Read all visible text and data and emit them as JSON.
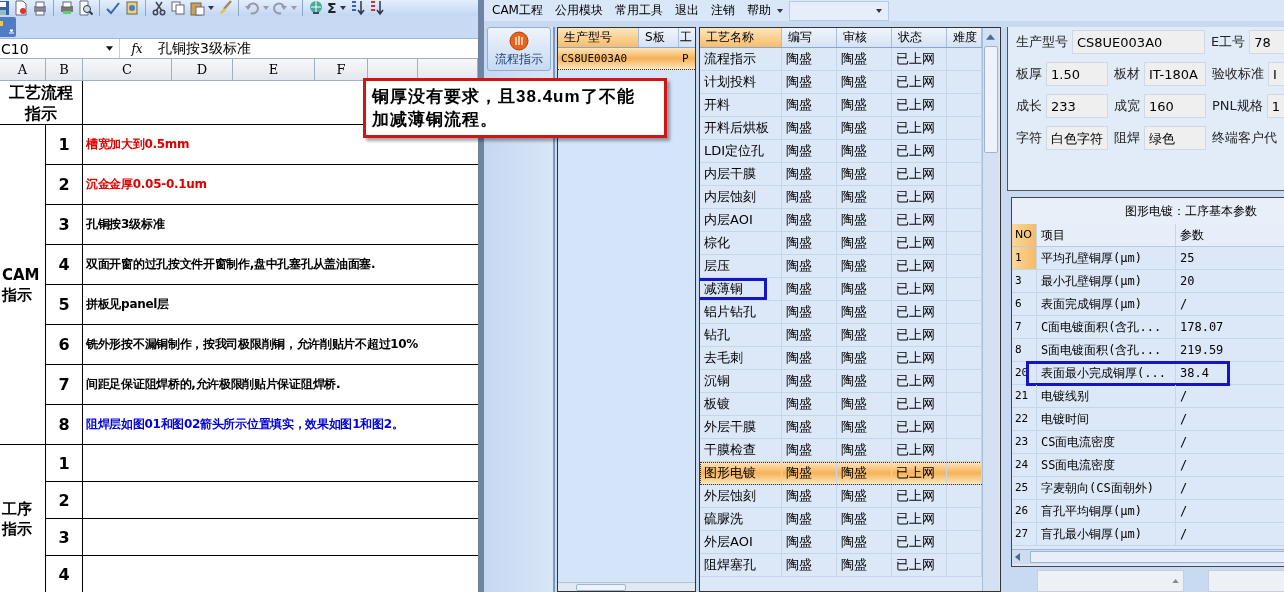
{
  "excel": {
    "toolbar_symbol": "Σ",
    "name_box": "C10",
    "fx": "fx",
    "formula": "孔铜按3级标准",
    "columns": [
      "A",
      "B",
      "C",
      "D",
      "E",
      "F",
      "",
      ""
    ],
    "header_label": "工艺流程指示",
    "groups": [
      {
        "label": "CAM指示",
        "rows": [
          {
            "no": "1",
            "text": "槽宽加大到0.5mm",
            "color": "#e00000"
          },
          {
            "no": "2",
            "text": "沉金金厚0.05-0.1um",
            "color": "#e00000"
          },
          {
            "no": "3",
            "text": "孔铜按3级标准",
            "color": "#000000"
          },
          {
            "no": "4",
            "text": "双面开窗的过孔按文件开窗制作,盘中孔塞孔从盖油面塞.",
            "color": "#000000"
          },
          {
            "no": "5",
            "text": "拼板见panel层",
            "color": "#000000"
          },
          {
            "no": "6",
            "text": "铣外形按不漏铜制作，按我司极限削铜，允许削贴片不超过10%",
            "color": "#000000"
          },
          {
            "no": "7",
            "text": "间距足保证阻焊桥的,允许极限削贴片保证阻焊桥.",
            "color": "#000000"
          },
          {
            "no": "8",
            "text": "阻焊层如图01和图02箭头所示位置填实，效果如图1和图2。",
            "color": "#0000dd"
          }
        ]
      },
      {
        "label": "工序指示",
        "rows": [
          {
            "no": "1"
          },
          {
            "no": "2"
          },
          {
            "no": "3"
          },
          {
            "no": "4"
          }
        ]
      }
    ]
  },
  "annotation": {
    "lines": [
      "铜厚没有要求，且38.4um了不能",
      "加减薄铜流程。"
    ]
  },
  "cam": {
    "menu": [
      "CAM工程",
      "公用模块",
      "常用工具",
      "退出",
      "注销",
      "帮助"
    ],
    "nav_button": "流程指示",
    "orders": {
      "columns": [
        {
          "label": "生产型号",
          "sorted": true
        },
        {
          "label": "S板",
          "sorted": false
        },
        {
          "label": "工",
          "sorted": false
        }
      ],
      "rows": [
        {
          "cells": [
            "CS8UE003A0",
            "",
            "P"
          ],
          "selected": true
        }
      ]
    },
    "processes": {
      "columns": [
        {
          "label": "工艺名称",
          "sorted": true
        },
        {
          "label": "编写",
          "sorted": false
        },
        {
          "label": "审核",
          "sorted": false
        },
        {
          "label": "状态",
          "sorted": false
        },
        {
          "label": "难度",
          "sorted": false
        }
      ],
      "rows": [
        {
          "name": "流程指示",
          "writer": "陶盛",
          "reviewer": "陶盛",
          "status": "已上网",
          "selected": false,
          "highlighted": false
        },
        {
          "name": "计划投料",
          "writer": "陶盛",
          "reviewer": "陶盛",
          "status": "已上网",
          "selected": false,
          "highlighted": false
        },
        {
          "name": "开料",
          "writer": "陶盛",
          "reviewer": "陶盛",
          "status": "已上网",
          "selected": false,
          "highlighted": false
        },
        {
          "name": "开料后烘板",
          "writer": "陶盛",
          "reviewer": "陶盛",
          "status": "已上网",
          "selected": false,
          "highlighted": false
        },
        {
          "name": "LDI定位孔",
          "writer": "陶盛",
          "reviewer": "陶盛",
          "status": "已上网",
          "selected": false,
          "highlighted": false
        },
        {
          "name": "内层干膜",
          "writer": "陶盛",
          "reviewer": "陶盛",
          "status": "已上网",
          "selected": false,
          "highlighted": false
        },
        {
          "name": "内层蚀刻",
          "writer": "陶盛",
          "reviewer": "陶盛",
          "status": "已上网",
          "selected": false,
          "highlighted": false
        },
        {
          "name": "内层AOI",
          "writer": "陶盛",
          "reviewer": "陶盛",
          "status": "已上网",
          "selected": false,
          "highlighted": false
        },
        {
          "name": "棕化",
          "writer": "陶盛",
          "reviewer": "陶盛",
          "status": "已上网",
          "selected": false,
          "highlighted": false
        },
        {
          "name": "层压",
          "writer": "陶盛",
          "reviewer": "陶盛",
          "status": "已上网",
          "selected": false,
          "highlighted": false
        },
        {
          "name": "减薄铜",
          "writer": "陶盛",
          "reviewer": "陶盛",
          "status": "已上网",
          "selected": false,
          "highlighted": true
        },
        {
          "name": "铝片钻孔",
          "writer": "陶盛",
          "reviewer": "陶盛",
          "status": "已上网",
          "selected": false,
          "highlighted": false
        },
        {
          "name": "钻孔",
          "writer": "陶盛",
          "reviewer": "陶盛",
          "status": "已上网",
          "selected": false,
          "highlighted": false
        },
        {
          "name": "去毛刺",
          "writer": "陶盛",
          "reviewer": "陶盛",
          "status": "已上网",
          "selected": false,
          "highlighted": false
        },
        {
          "name": "沉铜",
          "writer": "陶盛",
          "reviewer": "陶盛",
          "status": "已上网",
          "selected": false,
          "highlighted": false
        },
        {
          "name": "板镀",
          "writer": "陶盛",
          "reviewer": "陶盛",
          "status": "已上网",
          "selected": false,
          "highlighted": false
        },
        {
          "name": "外层干膜",
          "writer": "陶盛",
          "reviewer": "陶盛",
          "status": "已上网",
          "selected": false,
          "highlighted": false
        },
        {
          "name": "干膜检查",
          "writer": "陶盛",
          "reviewer": "陶盛",
          "status": "已上网",
          "selected": false,
          "highlighted": false
        },
        {
          "name": "图形电镀",
          "writer": "陶盛",
          "reviewer": "陶盛",
          "status": "已上网",
          "selected": true,
          "highlighted": false
        },
        {
          "name": "外层蚀刻",
          "writer": "陶盛",
          "reviewer": "陶盛",
          "status": "已上网",
          "selected": false,
          "highlighted": false
        },
        {
          "name": "硫脲洗",
          "writer": "陶盛",
          "reviewer": "陶盛",
          "status": "已上网",
          "selected": false,
          "highlighted": false
        },
        {
          "name": "外层AOI",
          "writer": "陶盛",
          "reviewer": "陶盛",
          "status": "已上网",
          "selected": false,
          "highlighted": false
        },
        {
          "name": "阻焊塞孔",
          "writer": "陶盛",
          "reviewer": "陶盛",
          "status": "已上网",
          "selected": false,
          "highlighted": false
        }
      ]
    },
    "info": [
      [
        {
          "label": "生产型号",
          "value": "CS8UE003A0"
        },
        {
          "label": "E工号",
          "value": "78"
        }
      ],
      [
        {
          "label": "板厚",
          "value": "1.50"
        },
        {
          "label": "板材",
          "value": "IT-180A"
        },
        {
          "label": "验收标准",
          "value": "I"
        }
      ],
      [
        {
          "label": "成长",
          "value": "233"
        },
        {
          "label": "成宽",
          "value": "160"
        },
        {
          "label": "PNL规格",
          "value": "1"
        }
      ],
      [
        {
          "label": "字符",
          "value": "白色字符"
        },
        {
          "label": "阻焊",
          "value": "绿色"
        },
        {
          "label": "终端客户代"
        }
      ]
    ],
    "params": {
      "title": "图形电镀：工序基本参数",
      "columns": [
        "NO",
        "项目",
        "参数"
      ],
      "rows": [
        {
          "no": "1",
          "item": "平均孔壁铜厚(μm)",
          "value": "25",
          "selected": true,
          "highlighted": false
        },
        {
          "no": "3",
          "item": "最小孔壁铜厚(μm)",
          "value": "20",
          "selected": false,
          "highlighted": false
        },
        {
          "no": "6",
          "item": "表面完成铜厚(μm)",
          "value": "/",
          "selected": false,
          "highlighted": false
        },
        {
          "no": "7",
          "item": "C面电镀面积(含孔...",
          "value": "178.07",
          "selected": false,
          "highlighted": false
        },
        {
          "no": "8",
          "item": "S面电镀面积(含孔...",
          "value": "219.59",
          "selected": false,
          "highlighted": false
        },
        {
          "no": "20",
          "item": "表面最小完成铜厚(...",
          "value": "38.4",
          "selected": false,
          "highlighted": true
        },
        {
          "no": "21",
          "item": "电镀线别",
          "value": "/",
          "selected": false,
          "highlighted": false
        },
        {
          "no": "22",
          "item": "电镀时间",
          "value": "/",
          "selected": false,
          "highlighted": false
        },
        {
          "no": "23",
          "item": "CS面电流密度",
          "value": "/",
          "selected": false,
          "highlighted": false
        },
        {
          "no": "24",
          "item": "SS面电流密度",
          "value": "/",
          "selected": false,
          "highlighted": false
        },
        {
          "no": "25",
          "item": "字麦朝向(CS面朝外)",
          "value": "/",
          "selected": false,
          "highlighted": false
        },
        {
          "no": "26",
          "item": "盲孔平均铜厚(μm)",
          "value": "/",
          "selected": false,
          "highlighted": false
        },
        {
          "no": "27",
          "item": "盲孔最小铜厚(μm)",
          "value": "/",
          "selected": false,
          "highlighted": false
        }
      ]
    }
  }
}
